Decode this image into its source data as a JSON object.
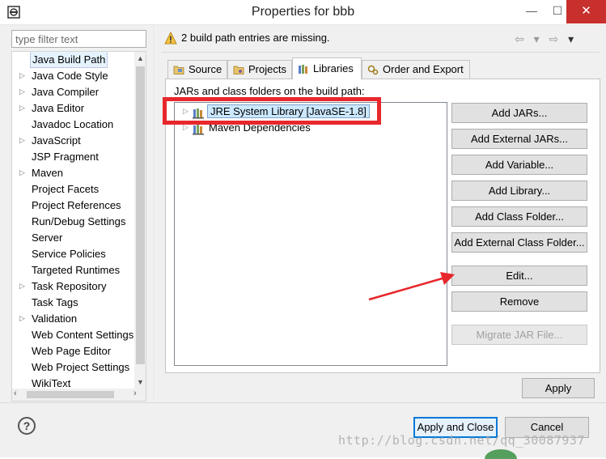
{
  "window": {
    "title": "Properties for bbb",
    "minimize": "—",
    "maximize": "☐",
    "close": "✕"
  },
  "filter": {
    "placeholder": "type filter text"
  },
  "nav": {
    "items": [
      {
        "label": "Java Build Path",
        "expandable": false,
        "selected": true
      },
      {
        "label": "Java Code Style",
        "expandable": true
      },
      {
        "label": "Java Compiler",
        "expandable": true
      },
      {
        "label": "Java Editor",
        "expandable": true
      },
      {
        "label": "Javadoc Location",
        "expandable": false
      },
      {
        "label": "JavaScript",
        "expandable": true
      },
      {
        "label": "JSP Fragment",
        "expandable": false
      },
      {
        "label": "Maven",
        "expandable": true
      },
      {
        "label": "Project Facets",
        "expandable": false
      },
      {
        "label": "Project References",
        "expandable": false
      },
      {
        "label": "Run/Debug Settings",
        "expandable": false
      },
      {
        "label": "Server",
        "expandable": false
      },
      {
        "label": "Service Policies",
        "expandable": false
      },
      {
        "label": "Targeted Runtimes",
        "expandable": false
      },
      {
        "label": "Task Repository",
        "expandable": true
      },
      {
        "label": "Task Tags",
        "expandable": false
      },
      {
        "label": "Validation",
        "expandable": true
      },
      {
        "label": "Web Content Settings",
        "expandable": false
      },
      {
        "label": "Web Page Editor",
        "expandable": false
      },
      {
        "label": "Web Project Settings",
        "expandable": false
      },
      {
        "label": "WikiText",
        "expandable": false
      }
    ],
    "arrow": "▷"
  },
  "header": {
    "message": "2 build path entries are missing.",
    "back": "⇦",
    "forward": "⇨",
    "menu": "▾"
  },
  "tabs": [
    {
      "label": "Source",
      "icon": "source-folder-icon"
    },
    {
      "label": "Projects",
      "icon": "projects-icon"
    },
    {
      "label": "Libraries",
      "icon": "library-icon",
      "active": true
    },
    {
      "label": "Order and Export",
      "icon": "order-icon"
    }
  ],
  "libraries": {
    "caption": "JARs and class folders on the build path:",
    "entries": [
      {
        "label": "JRE System Library [JavaSE-1.8]",
        "selected": true
      },
      {
        "label": "Maven Dependencies"
      }
    ]
  },
  "buttons": {
    "add_jars": "Add JARs...",
    "add_external_jars": "Add External JARs...",
    "add_variable": "Add Variable...",
    "add_library": "Add Library...",
    "add_class_folder": "Add Class Folder...",
    "add_external_class_folder": "Add External Class Folder...",
    "edit": "Edit...",
    "remove": "Remove",
    "migrate_jar": "Migrate JAR File...",
    "apply": "Apply",
    "apply_and_close": "Apply and Close",
    "cancel": "Cancel",
    "help": "?"
  },
  "watermark": "http://blog.csdn.net/qq_30087937",
  "colors": {
    "annotation_red": "#e8272c",
    "close_red": "#c7302d",
    "default_button_blue": "#0078d7"
  }
}
